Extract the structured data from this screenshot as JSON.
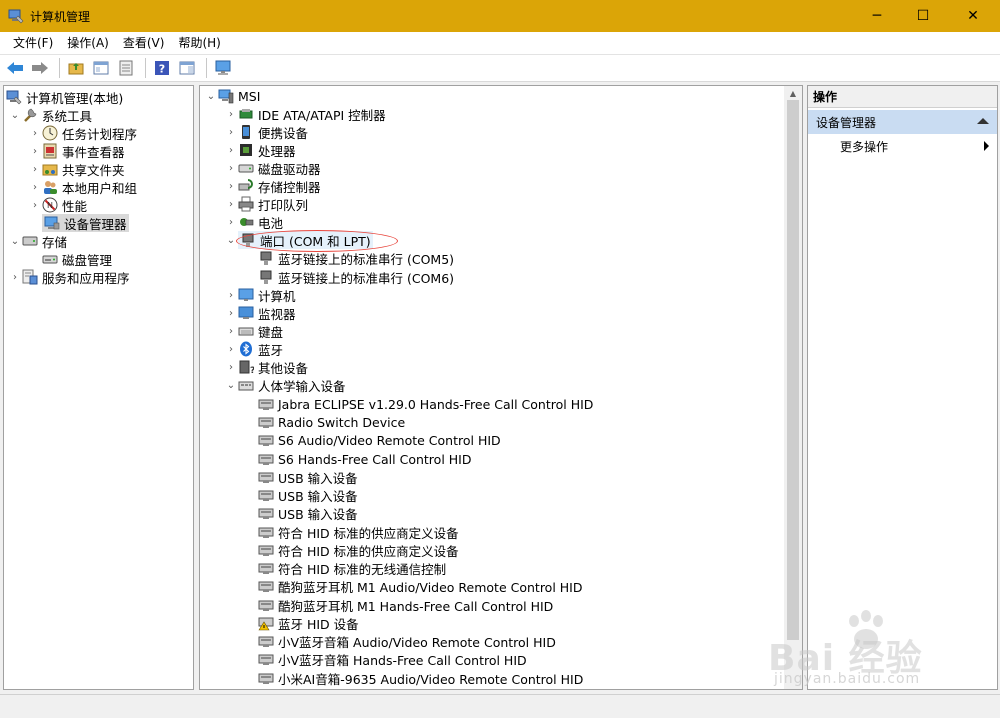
{
  "window": {
    "title": "计算机管理",
    "controls": {
      "minimize": "─",
      "maximize": "☐",
      "close": "✕"
    }
  },
  "menu": [
    "文件(F)",
    "操作(A)",
    "查看(V)",
    "帮助(H)"
  ],
  "toolbar": {
    "icons": [
      "back-arrow-icon",
      "forward-arrow-icon",
      "up-folder-icon",
      "show-hide-tree-icon",
      "properties-icon",
      "help-icon",
      "action-pane-icon",
      "monitor-icon"
    ]
  },
  "left_tree": {
    "root": "计算机管理(本地)",
    "system_tools": "系统工具",
    "task_scheduler": "任务计划程序",
    "event_viewer": "事件查看器",
    "shared_folders": "共享文件夹",
    "local_users": "本地用户和组",
    "performance": "性能",
    "device_manager": "设备管理器",
    "storage": "存储",
    "disk_management": "磁盘管理",
    "services_apps": "服务和应用程序"
  },
  "devices": {
    "computer_name": "MSI",
    "ide": "IDE ATA/ATAPI 控制器",
    "portable": "便携设备",
    "processor": "处理器",
    "disk_drives": "磁盘驱动器",
    "storage_controllers": "存储控制器",
    "print_queues": "打印队列",
    "battery": "电池",
    "ports": "端口 (COM 和 LPT)",
    "port_children": [
      "蓝牙链接上的标准串行 (COM5)",
      "蓝牙链接上的标准串行 (COM6)"
    ],
    "computer": "计算机",
    "monitors": "监视器",
    "keyboard": "键盘",
    "bluetooth": "蓝牙",
    "other_devices": "其他设备",
    "hid": "人体学输入设备",
    "hid_children": [
      "Jabra ECLIPSE v1.29.0 Hands-Free Call Control HID",
      "Radio Switch Device",
      "S6 Audio/Video Remote Control HID",
      "S6 Hands-Free Call Control HID",
      "USB 输入设备",
      "USB 输入设备",
      "USB 输入设备",
      "符合 HID 标准的供应商定义设备",
      "符合 HID 标准的供应商定义设备",
      "符合 HID 标准的无线通信控制",
      "酷狗蓝牙耳机 M1 Audio/Video Remote Control HID",
      "酷狗蓝牙耳机 M1 Hands-Free Call Control HID",
      "蓝牙 HID 设备",
      "小V蓝牙音箱 Audio/Video Remote Control HID",
      "小V蓝牙音箱 Hands-Free Call Control HID",
      "小米AI音箱-9635 Audio/Video Remote Control HID"
    ]
  },
  "actions": {
    "header": "操作",
    "section": "设备管理器",
    "more": "更多操作"
  },
  "watermark": {
    "main": "Bai 经验",
    "sub": "jingyan.baidu.com"
  },
  "colors": {
    "titlebar": "#dba507",
    "selection": "#d9d9d9",
    "actions_section": "#c9dcf2",
    "annotation": "#e8453c"
  }
}
